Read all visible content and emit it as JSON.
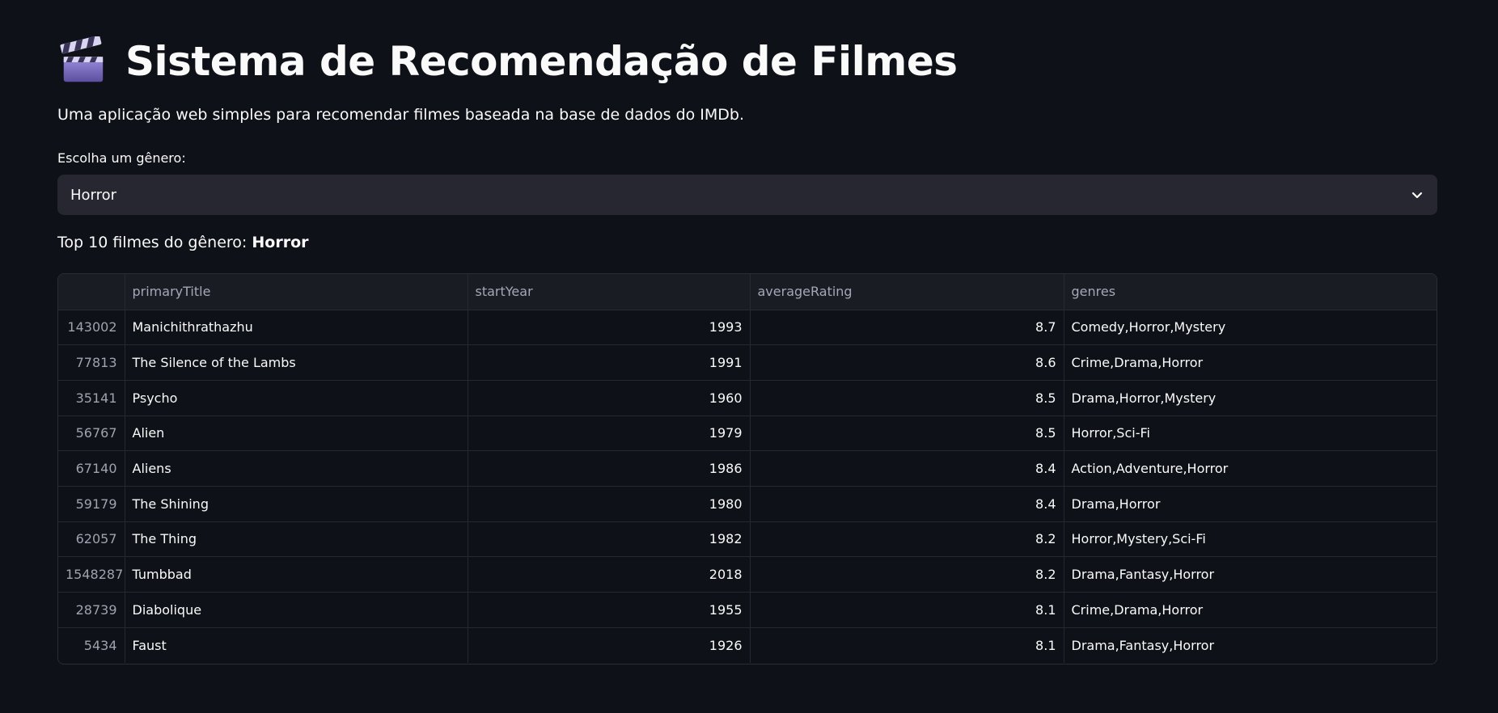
{
  "header": {
    "icon": "clapper-board-icon",
    "title": "Sistema de Recomendação de Filmes",
    "subtitle": "Uma aplicação web simples para recomendar filmes baseada na base de dados do IMDb."
  },
  "genre_select": {
    "label": "Escolha um gênero:",
    "value": "Horror"
  },
  "results": {
    "prefix": "Top 10 filmes do gênero: ",
    "genre": "Horror"
  },
  "table": {
    "columns": [
      "",
      "primaryTitle",
      "startYear",
      "averageRating",
      "genres"
    ],
    "rows": [
      {
        "index": "143002",
        "primaryTitle": "Manichithrathazhu",
        "startYear": "1993",
        "averageRating": "8.7",
        "genres": "Comedy,Horror,Mystery"
      },
      {
        "index": "77813",
        "primaryTitle": "The Silence of the Lambs",
        "startYear": "1991",
        "averageRating": "8.6",
        "genres": "Crime,Drama,Horror"
      },
      {
        "index": "35141",
        "primaryTitle": "Psycho",
        "startYear": "1960",
        "averageRating": "8.5",
        "genres": "Drama,Horror,Mystery"
      },
      {
        "index": "56767",
        "primaryTitle": "Alien",
        "startYear": "1979",
        "averageRating": "8.5",
        "genres": "Horror,Sci-Fi"
      },
      {
        "index": "67140",
        "primaryTitle": "Aliens",
        "startYear": "1986",
        "averageRating": "8.4",
        "genres": "Action,Adventure,Horror"
      },
      {
        "index": "59179",
        "primaryTitle": "The Shining",
        "startYear": "1980",
        "averageRating": "8.4",
        "genres": "Drama,Horror"
      },
      {
        "index": "62057",
        "primaryTitle": "The Thing",
        "startYear": "1982",
        "averageRating": "8.2",
        "genres": "Horror,Mystery,Sci-Fi"
      },
      {
        "index": "1548287",
        "primaryTitle": "Tumbbad",
        "startYear": "2018",
        "averageRating": "8.2",
        "genres": "Drama,Fantasy,Horror"
      },
      {
        "index": "28739",
        "primaryTitle": "Diabolique",
        "startYear": "1955",
        "averageRating": "8.1",
        "genres": "Crime,Drama,Horror"
      },
      {
        "index": "5434",
        "primaryTitle": "Faust",
        "startYear": "1926",
        "averageRating": "8.1",
        "genres": "Drama,Fantasy,Horror"
      }
    ]
  },
  "colors": {
    "background": "#0e1117",
    "select_bg": "#262730",
    "text": "#fafafa",
    "muted_text": "#a3a8b8",
    "grid_border": "#262832"
  }
}
